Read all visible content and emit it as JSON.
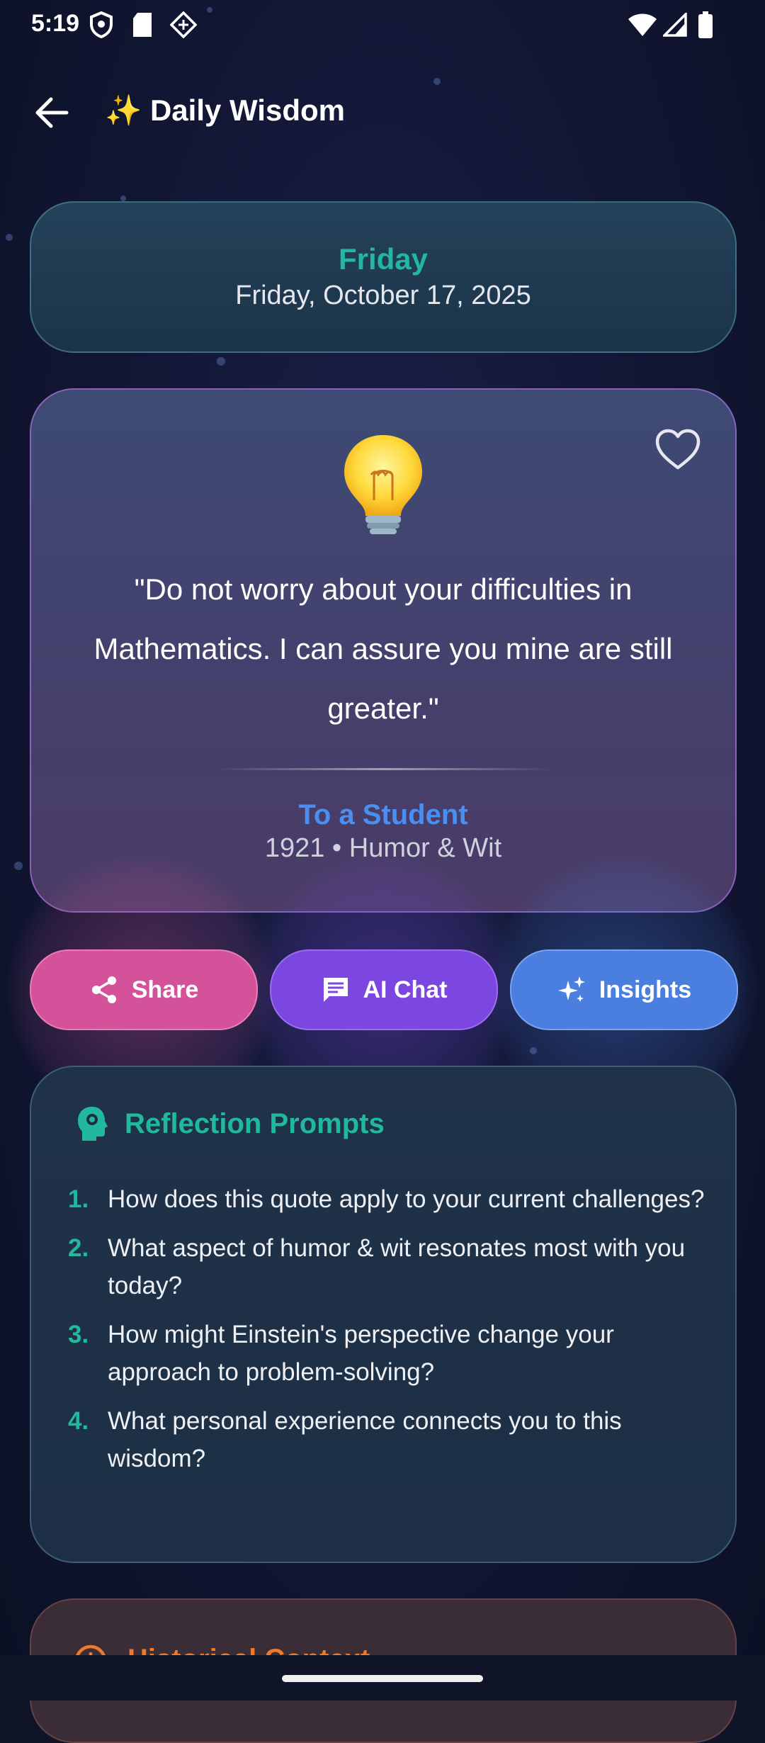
{
  "status_bar": {
    "time": "5:19"
  },
  "header": {
    "title": "✨ Daily Wisdom"
  },
  "date_card": {
    "day": "Friday",
    "full_date": "Friday, October 17, 2025"
  },
  "quote_card": {
    "quote": "\"Do not worry about your difficulties in Mathematics. I can assure you mine are still greater.\"",
    "source": "To a Student",
    "meta": "1921 • Humor & Wit"
  },
  "actions": {
    "share": "Share",
    "ai_chat": "AI Chat",
    "insights": "Insights"
  },
  "reflection": {
    "title": "Reflection Prompts",
    "prompts": [
      {
        "num": "1.",
        "text": "How does this quote apply to your current challenges?"
      },
      {
        "num": "2.",
        "text": "What aspect of humor & wit resonates most with you today?"
      },
      {
        "num": "3.",
        "text": "How might Einstein's perspective change your approach to problem-solving?"
      },
      {
        "num": "4.",
        "text": "What personal experience connects you to this wisdom?"
      }
    ]
  },
  "historical": {
    "title": "Historical Context"
  },
  "colors": {
    "accent_teal": "#22b8a0",
    "accent_blue": "#4a8ff0",
    "share_pink": "#d4529a",
    "chat_purple": "#7c46e0",
    "insights_blue": "#4a7fe0",
    "history_orange": "#f07a2a"
  },
  "icons": {
    "back": "arrow-left-icon",
    "heart": "heart-outline-icon",
    "bulb": "light-bulb-icon",
    "share": "share-icon",
    "chat": "chat-bubble-icon",
    "insights": "sparkles-icon",
    "reflection": "brain-head-icon",
    "history": "info-circle-icon"
  }
}
